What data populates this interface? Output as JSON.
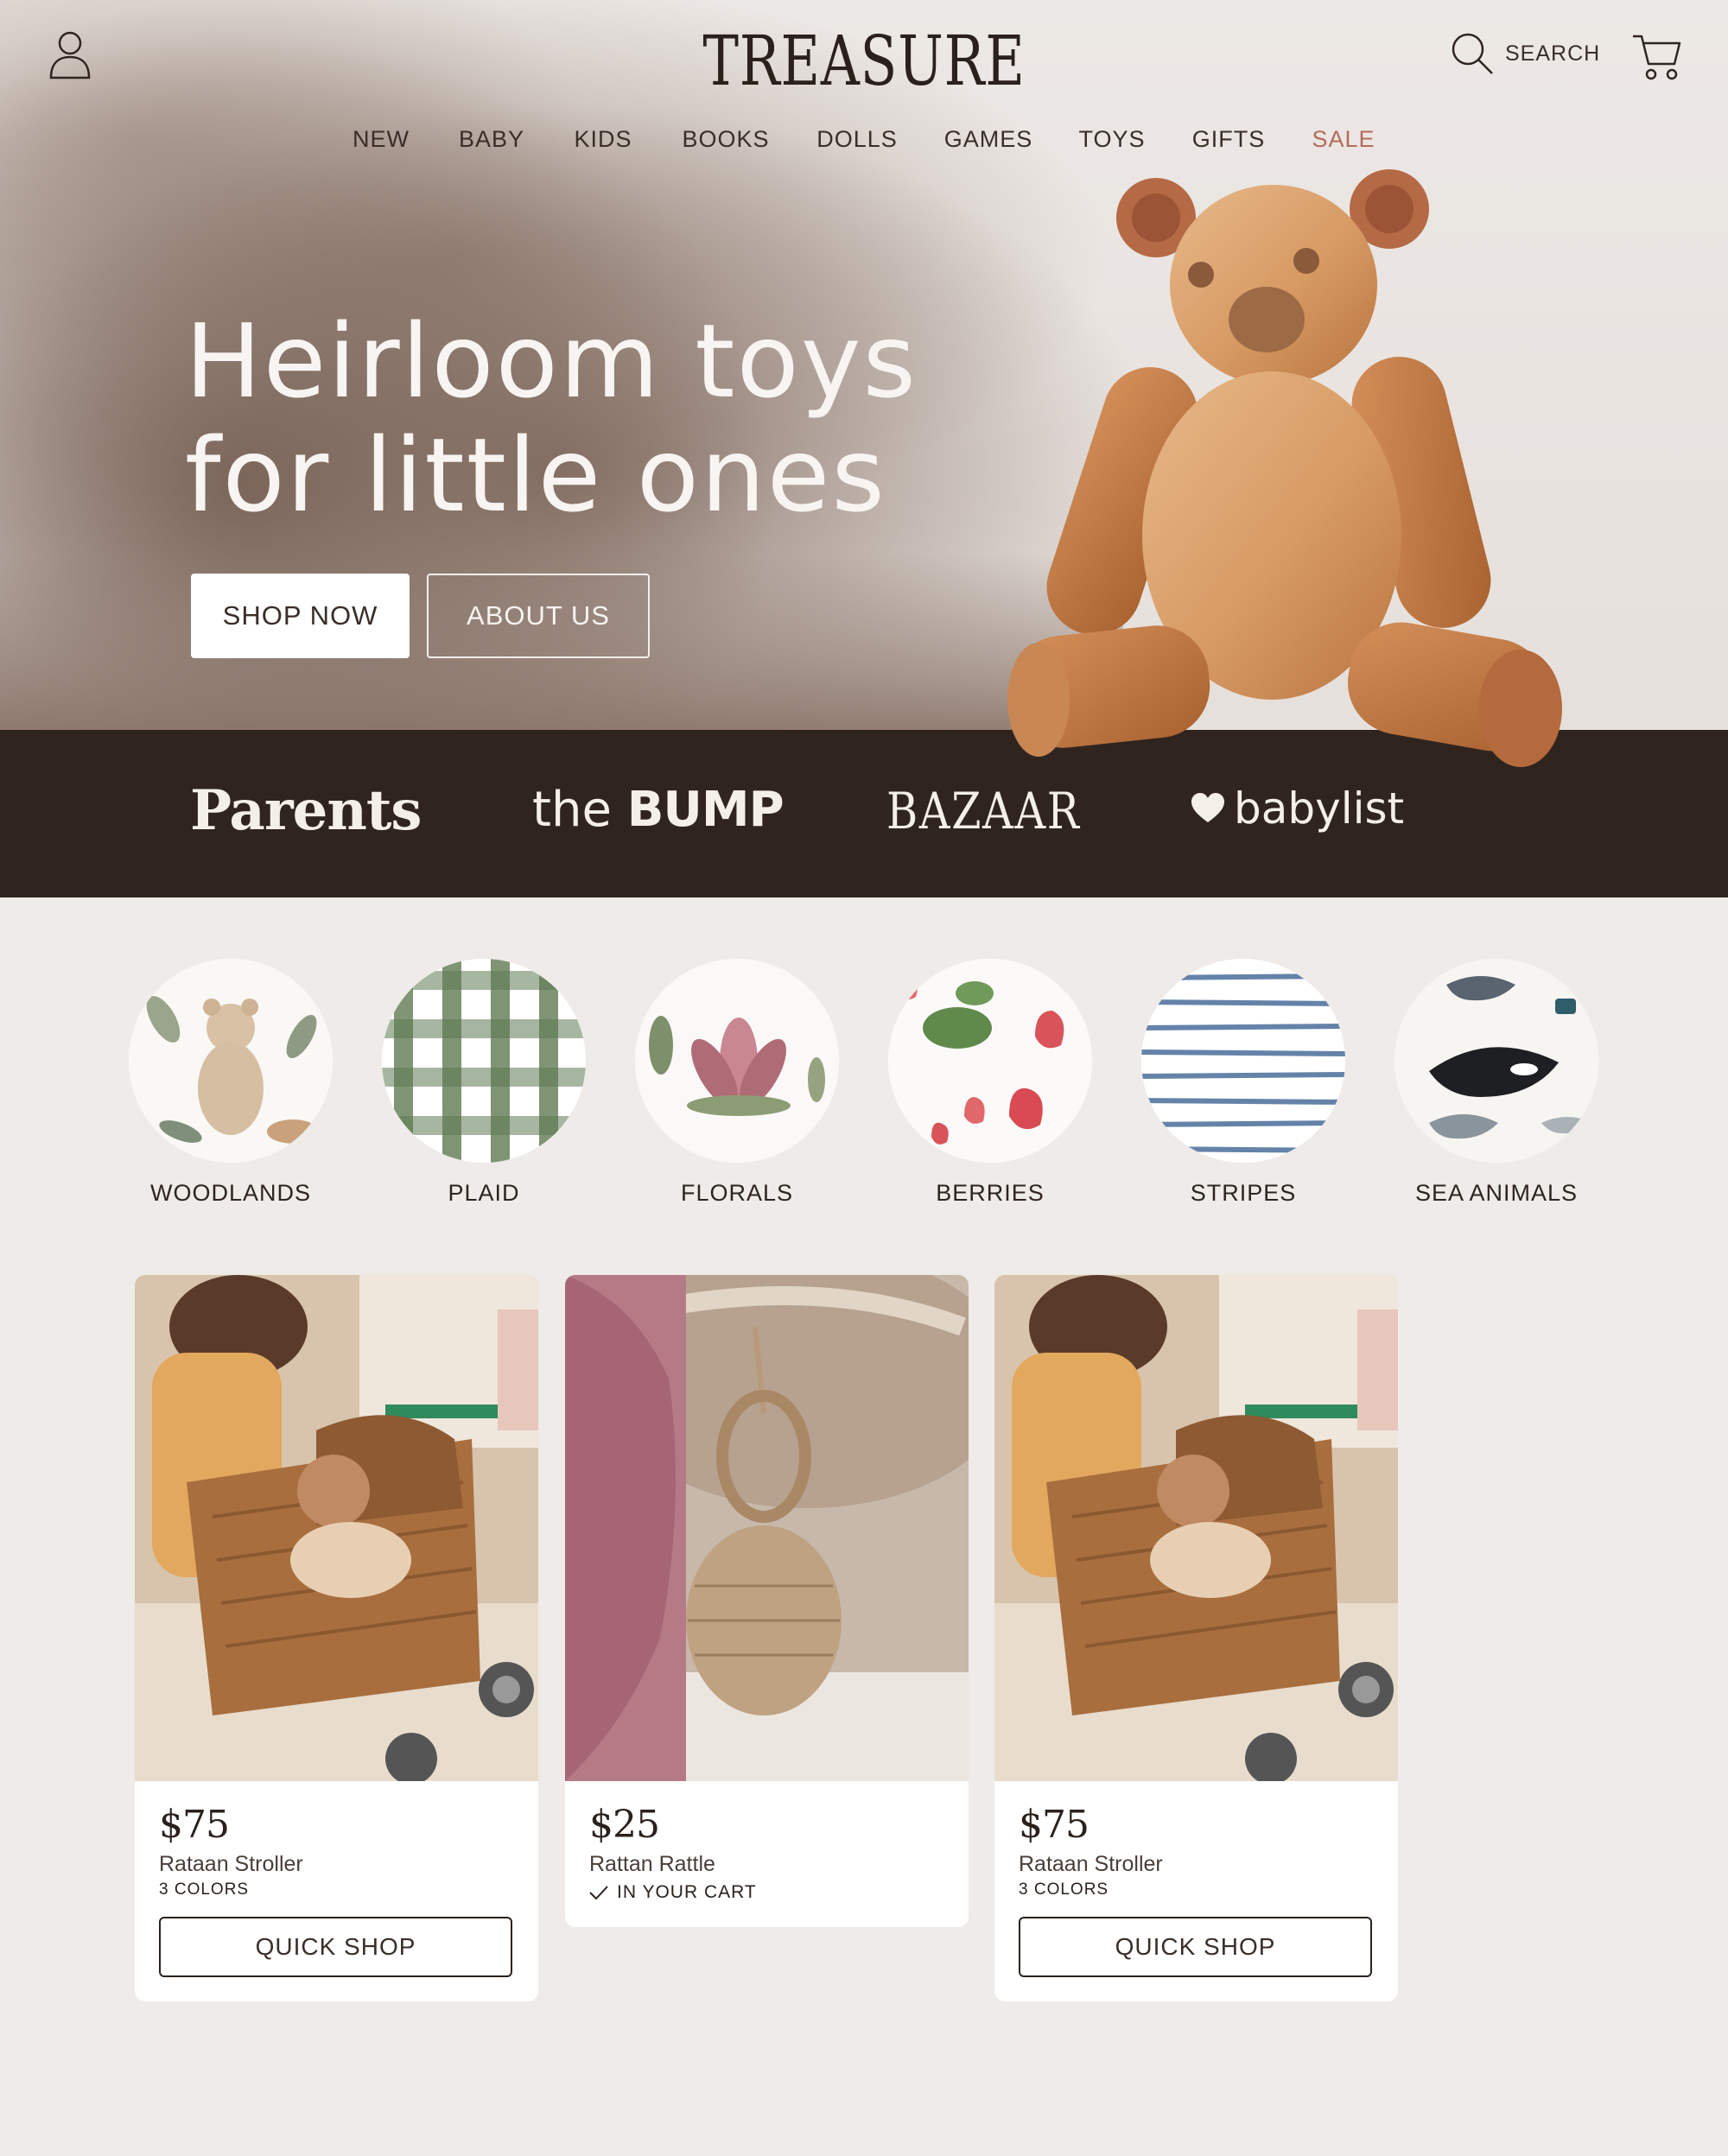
{
  "header": {
    "logo": "TREASURE",
    "search_label": "SEARCH",
    "icons": [
      "profile-icon",
      "search-icon",
      "cart-icon"
    ]
  },
  "nav": {
    "items": [
      "NEW",
      "BABY",
      "KIDS",
      "BOOKS",
      "DOLLS",
      "GAMES",
      "TOYS",
      "GIFTS",
      "SALE"
    ],
    "sale_color": "#b56a5a"
  },
  "hero": {
    "headline_line1": "Heirloom toys",
    "headline_line2": "for little ones",
    "shop_now": "SHOP NOW",
    "about_us": "ABOUT US"
  },
  "press": {
    "logos": [
      "Parents",
      "the",
      "BUMP",
      "BAZAAR",
      "babylist"
    ]
  },
  "categories": [
    {
      "label": "WOODLANDS"
    },
    {
      "label": "PLAID"
    },
    {
      "label": "FLORALS"
    },
    {
      "label": "BERRIES"
    },
    {
      "label": "STRIPES"
    },
    {
      "label": "SEA ANIMALS"
    }
  ],
  "products": [
    {
      "price": "$75",
      "name": "Rataan Stroller",
      "meta": "3 COLORS",
      "button": "QUICK SHOP"
    },
    {
      "price": "$25",
      "name": "Rattan Rattle",
      "status": "IN YOUR CART"
    },
    {
      "price": "$75",
      "name": "Rataan Stroller",
      "meta": "3 COLORS",
      "button": "QUICK SHOP"
    }
  ],
  "colors": {
    "background": "#eeebe8",
    "dark_brown": "#30241e",
    "accent_sale": "#b56a5a"
  }
}
